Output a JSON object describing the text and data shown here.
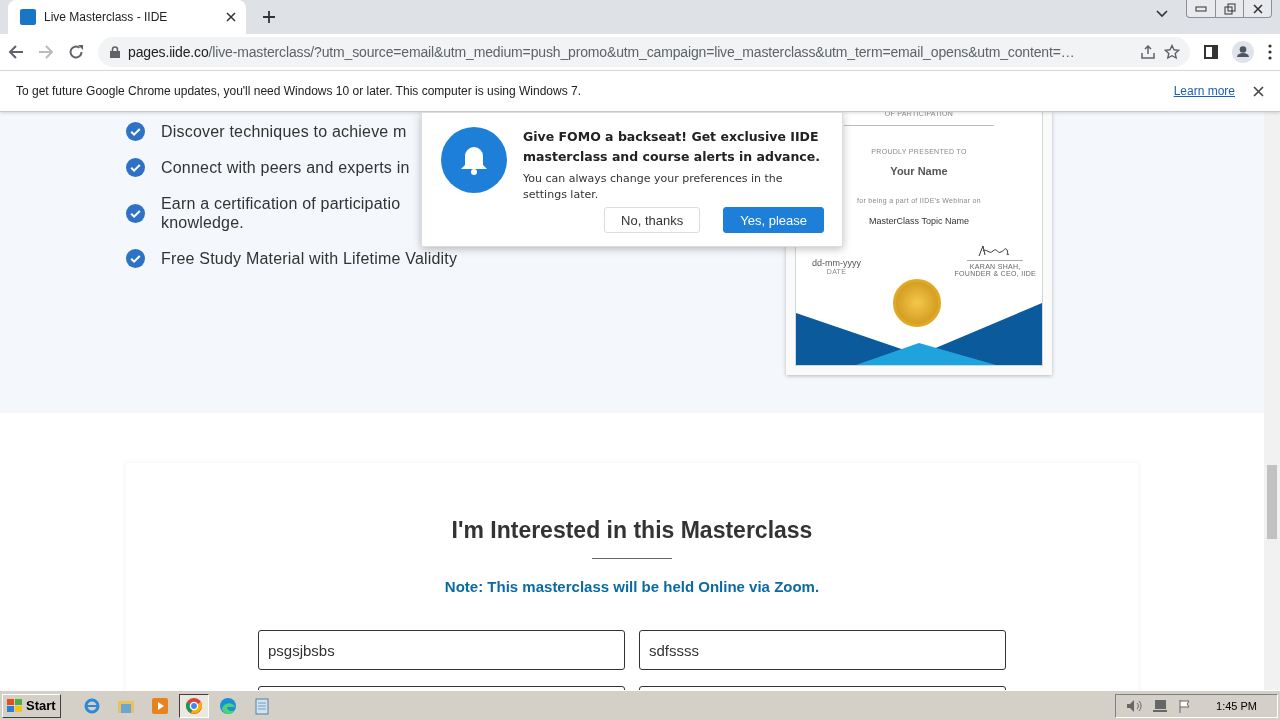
{
  "tab": {
    "title": "Live Masterclass - IIDE",
    "selected": true
  },
  "address_bar": {
    "host": "pages.iide.co",
    "path": "/live-masterclass/?utm_source=email&utm_medium=push_promo&utm_campaign=live_masterclass&utm_term=email_opens&utm_content=…"
  },
  "info_bar": {
    "message": "To get future Google Chrome updates, you'll need Windows 10 or later. This computer is using Windows 7.",
    "link": "Learn more"
  },
  "features": [
    {
      "lines": [
        "Discover techniques to achieve m"
      ]
    },
    {
      "lines": [
        "Connect with peers and experts in"
      ]
    },
    {
      "lines": [
        "Earn a certification of participatio",
        "knowledge."
      ]
    },
    {
      "lines": [
        "Free Study Material with Lifetime Validity"
      ]
    }
  ],
  "certificate": {
    "heading": "OF PARTICIPATION",
    "presented": "PROUDLY PRESENTED TO",
    "name": "Your Name",
    "reason": "for being a part of IIDE's Webinar on",
    "topic": "MasterClass Topic Name",
    "date": "dd-mm-yyyy",
    "date_label": "DATE",
    "signer": "KARAN SHAH,",
    "signer_title": "FOUNDER & CEO, IIDE"
  },
  "popup": {
    "title": "Give FOMO a backseat! Get exclusive IIDE masterclass and course alerts in advance.",
    "text": "You can always change your preferences in the settings later.",
    "buttons": [
      {
        "label": "No, thanks",
        "kind": "secondary"
      },
      {
        "label": "Yes, please",
        "kind": "primary"
      }
    ]
  },
  "form": {
    "title": "I'm Interested in this Masterclass",
    "note": "Note: This masterclass will be held Online via Zoom.",
    "fields": [
      {
        "kind": "text",
        "value": "psgsjbsbs"
      },
      {
        "kind": "text",
        "value": "sdfssss"
      },
      {
        "kind": "text"
      },
      {
        "kind": "text"
      }
    ]
  },
  "taskbar": {
    "start": "Start",
    "apps": [
      {
        "kind": "ie",
        "selected": false
      },
      {
        "kind": "folder",
        "selected": false
      },
      {
        "kind": "media",
        "selected": false
      },
      {
        "kind": "chrome",
        "selected": true
      },
      {
        "kind": "edge",
        "selected": false
      },
      {
        "kind": "notepad",
        "selected": false
      }
    ],
    "clock": "1:45 PM"
  }
}
